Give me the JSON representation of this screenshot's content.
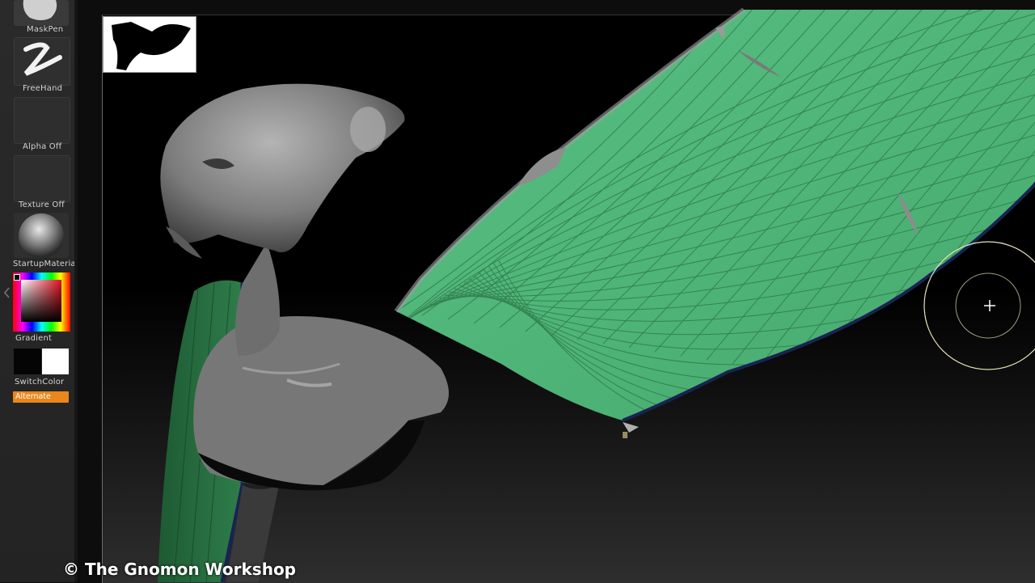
{
  "shelf": {
    "maskpen_label": "MaskPen",
    "freehand_label": "FreeHand",
    "alpha_label": "Alpha Off",
    "texture_label": "Texture Off",
    "material_label": "StartupMateria",
    "gradient_label": "Gradient",
    "switchcolor_label": "SwitchColor",
    "alternate_label": "Alternate"
  },
  "colors": {
    "mesh_green": "#52b878",
    "sculpt_gray": "#8a8a8a",
    "alternate_orange": "#e8871c",
    "cursor_ring": "#e6e2b8"
  },
  "watermark": "© The Gnomon Workshop"
}
